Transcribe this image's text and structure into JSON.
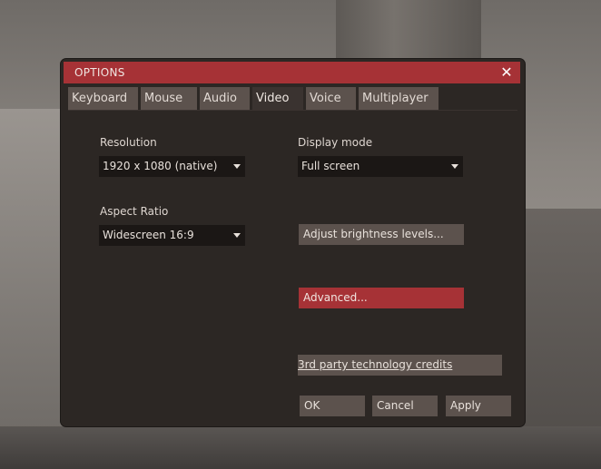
{
  "window": {
    "title": "OPTIONS",
    "close_symbol": "✕"
  },
  "tabs": [
    {
      "label": "Keyboard",
      "active": false
    },
    {
      "label": "Mouse",
      "active": false
    },
    {
      "label": "Audio",
      "active": false
    },
    {
      "label": "Video",
      "active": true
    },
    {
      "label": "Voice",
      "active": false
    },
    {
      "label": "Multiplayer",
      "active": false
    }
  ],
  "video": {
    "resolution": {
      "label": "Resolution",
      "value": "1920 x 1080 (native)"
    },
    "aspect_ratio": {
      "label": "Aspect Ratio",
      "value": "Widescreen 16:9"
    },
    "display_mode": {
      "label": "Display mode",
      "value": "Full screen"
    },
    "brightness_button": "Adjust brightness levels...",
    "advanced_button": "Advanced...",
    "credits_button": "3rd party technology credits"
  },
  "footer": {
    "ok": "OK",
    "cancel": "Cancel",
    "apply": "Apply"
  },
  "colors": {
    "accent": "#a63236",
    "panel": "#2c2724",
    "tab": "#5c524d",
    "field": "#1b1715"
  }
}
